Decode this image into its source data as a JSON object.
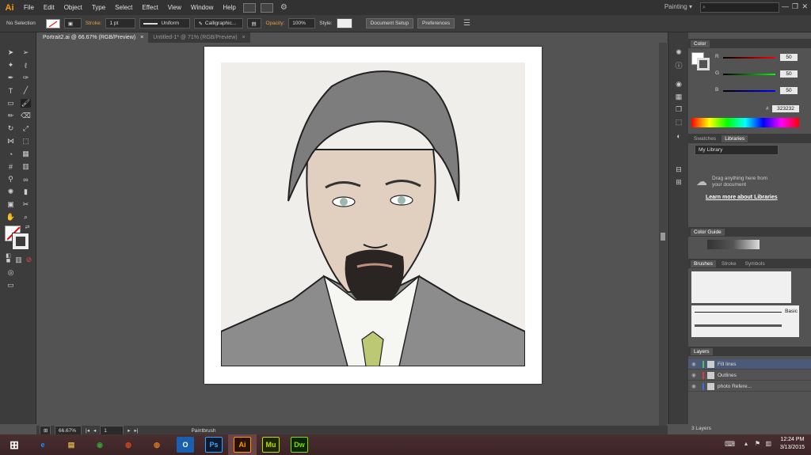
{
  "app": {
    "logo": "Ai",
    "workspace": "Painting",
    "search_placeholder": ""
  },
  "menu": [
    "File",
    "Edit",
    "Object",
    "Type",
    "Select",
    "Effect",
    "View",
    "Window",
    "Help"
  ],
  "control": {
    "selection": "No Selection",
    "stroke_label": "Stroke:",
    "stroke_value": "1 pt",
    "profile": "Uniform",
    "brush": "Calligraphic...",
    "opacity_label": "Opacity:",
    "opacity_value": "100%",
    "style_label": "Style:",
    "doc_setup": "Document Setup",
    "preferences": "Preferences"
  },
  "tabs": [
    {
      "label": "Portrait2.ai @ 66.67% (RGB/Preview)",
      "close": "×"
    },
    {
      "label": "Untitled-1* @ 71% (RGB/Preview)",
      "close": "×"
    }
  ],
  "status": {
    "zoom": "66.67%",
    "page": "1",
    "tool": "Paintbrush"
  },
  "color_panel": {
    "title": "Color",
    "r_label": "R",
    "r_value": "50",
    "g_label": "G",
    "g_value": "50",
    "b_label": "B",
    "b_value": "50",
    "hash": "#",
    "hex": "323232"
  },
  "libraries": {
    "tabs": [
      "Swatches",
      "Libraries"
    ],
    "dropdown": "My Library",
    "drag_text": "Drag anything here from your document",
    "learn_more": "Learn more about Libraries"
  },
  "color_guide": {
    "title": "Color Guide"
  },
  "brushes": {
    "tabs": [
      "Brushes",
      "Stroke",
      "Symbols"
    ],
    "basic": "Basic"
  },
  "layers": {
    "title": "Layers",
    "items": [
      {
        "name": "Fill lines",
        "color": "#4fc44f"
      },
      {
        "name": "Outlines",
        "color": "#e03a3a"
      },
      {
        "name": "photo Refere...",
        "color": "#3a6ee0"
      }
    ],
    "count": "3 Layers"
  },
  "taskbar": {
    "apps": [
      {
        "name": "ie",
        "label": "e",
        "bg": "#1e90ff"
      },
      {
        "name": "explorer",
        "label": "▤",
        "bg": "#e2b24a"
      },
      {
        "name": "chrome",
        "label": "◉",
        "bg": "#3a9a3a"
      },
      {
        "name": "firefox-dev",
        "label": "◍",
        "bg": "#d34a1a"
      },
      {
        "name": "firefox",
        "label": "◍",
        "bg": "#e07a1a"
      },
      {
        "name": "outlook",
        "label": "O",
        "bg": "#1b5fb0"
      },
      {
        "name": "photoshop",
        "label": "Ps",
        "bg": "#0e1b2e",
        "color": "#31a8ff"
      },
      {
        "name": "illustrator",
        "label": "Ai",
        "bg": "#2a1200",
        "color": "#ff9a00"
      },
      {
        "name": "muse",
        "label": "Mu",
        "bg": "#1e2600",
        "color": "#b8e000"
      },
      {
        "name": "dreamweaver",
        "label": "Dw",
        "bg": "#0e2600",
        "color": "#7ae000"
      }
    ],
    "time": "12:24 PM",
    "date": "3/13/2015"
  }
}
